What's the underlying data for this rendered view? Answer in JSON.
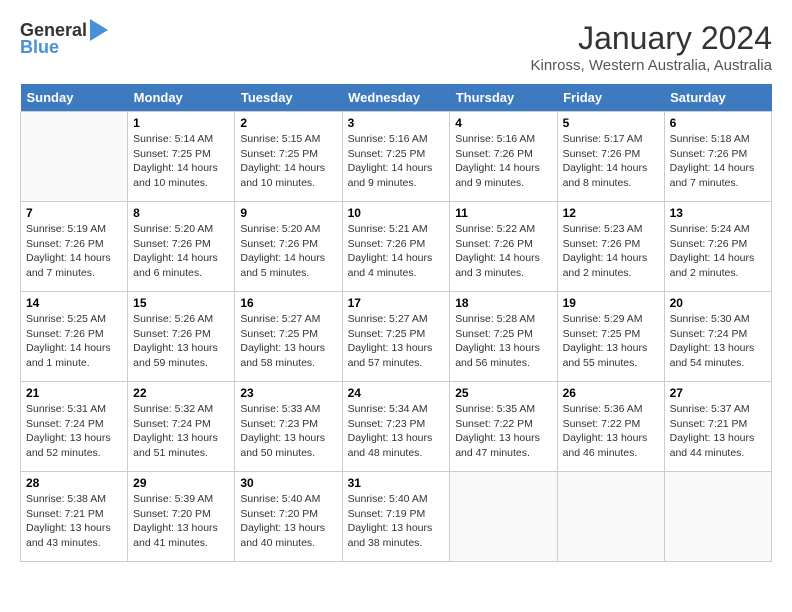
{
  "header": {
    "logo_general": "General",
    "logo_blue": "Blue",
    "month_title": "January 2024",
    "location": "Kinross, Western Australia, Australia"
  },
  "days_of_week": [
    "Sunday",
    "Monday",
    "Tuesday",
    "Wednesday",
    "Thursday",
    "Friday",
    "Saturday"
  ],
  "weeks": [
    [
      {
        "day": "",
        "info": ""
      },
      {
        "day": "1",
        "info": "Sunrise: 5:14 AM\nSunset: 7:25 PM\nDaylight: 14 hours\nand 10 minutes."
      },
      {
        "day": "2",
        "info": "Sunrise: 5:15 AM\nSunset: 7:25 PM\nDaylight: 14 hours\nand 10 minutes."
      },
      {
        "day": "3",
        "info": "Sunrise: 5:16 AM\nSunset: 7:25 PM\nDaylight: 14 hours\nand 9 minutes."
      },
      {
        "day": "4",
        "info": "Sunrise: 5:16 AM\nSunset: 7:26 PM\nDaylight: 14 hours\nand 9 minutes."
      },
      {
        "day": "5",
        "info": "Sunrise: 5:17 AM\nSunset: 7:26 PM\nDaylight: 14 hours\nand 8 minutes."
      },
      {
        "day": "6",
        "info": "Sunrise: 5:18 AM\nSunset: 7:26 PM\nDaylight: 14 hours\nand 7 minutes."
      }
    ],
    [
      {
        "day": "7",
        "info": "Sunrise: 5:19 AM\nSunset: 7:26 PM\nDaylight: 14 hours\nand 7 minutes."
      },
      {
        "day": "8",
        "info": "Sunrise: 5:20 AM\nSunset: 7:26 PM\nDaylight: 14 hours\nand 6 minutes."
      },
      {
        "day": "9",
        "info": "Sunrise: 5:20 AM\nSunset: 7:26 PM\nDaylight: 14 hours\nand 5 minutes."
      },
      {
        "day": "10",
        "info": "Sunrise: 5:21 AM\nSunset: 7:26 PM\nDaylight: 14 hours\nand 4 minutes."
      },
      {
        "day": "11",
        "info": "Sunrise: 5:22 AM\nSunset: 7:26 PM\nDaylight: 14 hours\nand 3 minutes."
      },
      {
        "day": "12",
        "info": "Sunrise: 5:23 AM\nSunset: 7:26 PM\nDaylight: 14 hours\nand 2 minutes."
      },
      {
        "day": "13",
        "info": "Sunrise: 5:24 AM\nSunset: 7:26 PM\nDaylight: 14 hours\nand 2 minutes."
      }
    ],
    [
      {
        "day": "14",
        "info": "Sunrise: 5:25 AM\nSunset: 7:26 PM\nDaylight: 14 hours\nand 1 minute."
      },
      {
        "day": "15",
        "info": "Sunrise: 5:26 AM\nSunset: 7:26 PM\nDaylight: 13 hours\nand 59 minutes."
      },
      {
        "day": "16",
        "info": "Sunrise: 5:27 AM\nSunset: 7:25 PM\nDaylight: 13 hours\nand 58 minutes."
      },
      {
        "day": "17",
        "info": "Sunrise: 5:27 AM\nSunset: 7:25 PM\nDaylight: 13 hours\nand 57 minutes."
      },
      {
        "day": "18",
        "info": "Sunrise: 5:28 AM\nSunset: 7:25 PM\nDaylight: 13 hours\nand 56 minutes."
      },
      {
        "day": "19",
        "info": "Sunrise: 5:29 AM\nSunset: 7:25 PM\nDaylight: 13 hours\nand 55 minutes."
      },
      {
        "day": "20",
        "info": "Sunrise: 5:30 AM\nSunset: 7:24 PM\nDaylight: 13 hours\nand 54 minutes."
      }
    ],
    [
      {
        "day": "21",
        "info": "Sunrise: 5:31 AM\nSunset: 7:24 PM\nDaylight: 13 hours\nand 52 minutes."
      },
      {
        "day": "22",
        "info": "Sunrise: 5:32 AM\nSunset: 7:24 PM\nDaylight: 13 hours\nand 51 minutes."
      },
      {
        "day": "23",
        "info": "Sunrise: 5:33 AM\nSunset: 7:23 PM\nDaylight: 13 hours\nand 50 minutes."
      },
      {
        "day": "24",
        "info": "Sunrise: 5:34 AM\nSunset: 7:23 PM\nDaylight: 13 hours\nand 48 minutes."
      },
      {
        "day": "25",
        "info": "Sunrise: 5:35 AM\nSunset: 7:22 PM\nDaylight: 13 hours\nand 47 minutes."
      },
      {
        "day": "26",
        "info": "Sunrise: 5:36 AM\nSunset: 7:22 PM\nDaylight: 13 hours\nand 46 minutes."
      },
      {
        "day": "27",
        "info": "Sunrise: 5:37 AM\nSunset: 7:21 PM\nDaylight: 13 hours\nand 44 minutes."
      }
    ],
    [
      {
        "day": "28",
        "info": "Sunrise: 5:38 AM\nSunset: 7:21 PM\nDaylight: 13 hours\nand 43 minutes."
      },
      {
        "day": "29",
        "info": "Sunrise: 5:39 AM\nSunset: 7:20 PM\nDaylight: 13 hours\nand 41 minutes."
      },
      {
        "day": "30",
        "info": "Sunrise: 5:40 AM\nSunset: 7:20 PM\nDaylight: 13 hours\nand 40 minutes."
      },
      {
        "day": "31",
        "info": "Sunrise: 5:40 AM\nSunset: 7:19 PM\nDaylight: 13 hours\nand 38 minutes."
      },
      {
        "day": "",
        "info": ""
      },
      {
        "day": "",
        "info": ""
      },
      {
        "day": "",
        "info": ""
      }
    ]
  ]
}
